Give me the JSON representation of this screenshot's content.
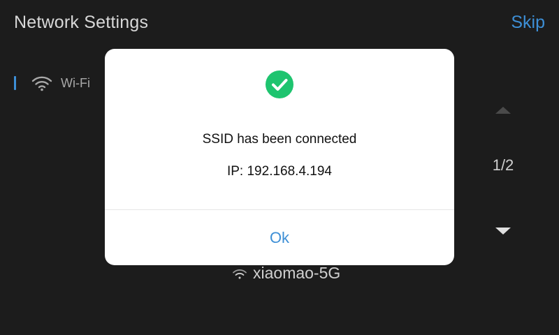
{
  "header": {
    "title": "Network Settings",
    "skip_label": "Skip"
  },
  "sidebar": {
    "items": [
      {
        "label": "Wi-Fi",
        "icon": "wifi-icon",
        "active": true
      }
    ]
  },
  "pager": {
    "count": "1/2"
  },
  "network_list": {
    "items": [
      {
        "name": "xiaomao-5G",
        "icon": "wifi-icon"
      }
    ]
  },
  "dialog": {
    "icon": "check-circle-icon",
    "message": "SSID has been connected",
    "ip_text": "IP: 192.168.4.194",
    "ok_label": "Ok"
  },
  "colors": {
    "background": "#1c1c1c",
    "accent": "#3d8fd6",
    "success": "#1ec46f",
    "dialog_bg": "#ffffff"
  }
}
